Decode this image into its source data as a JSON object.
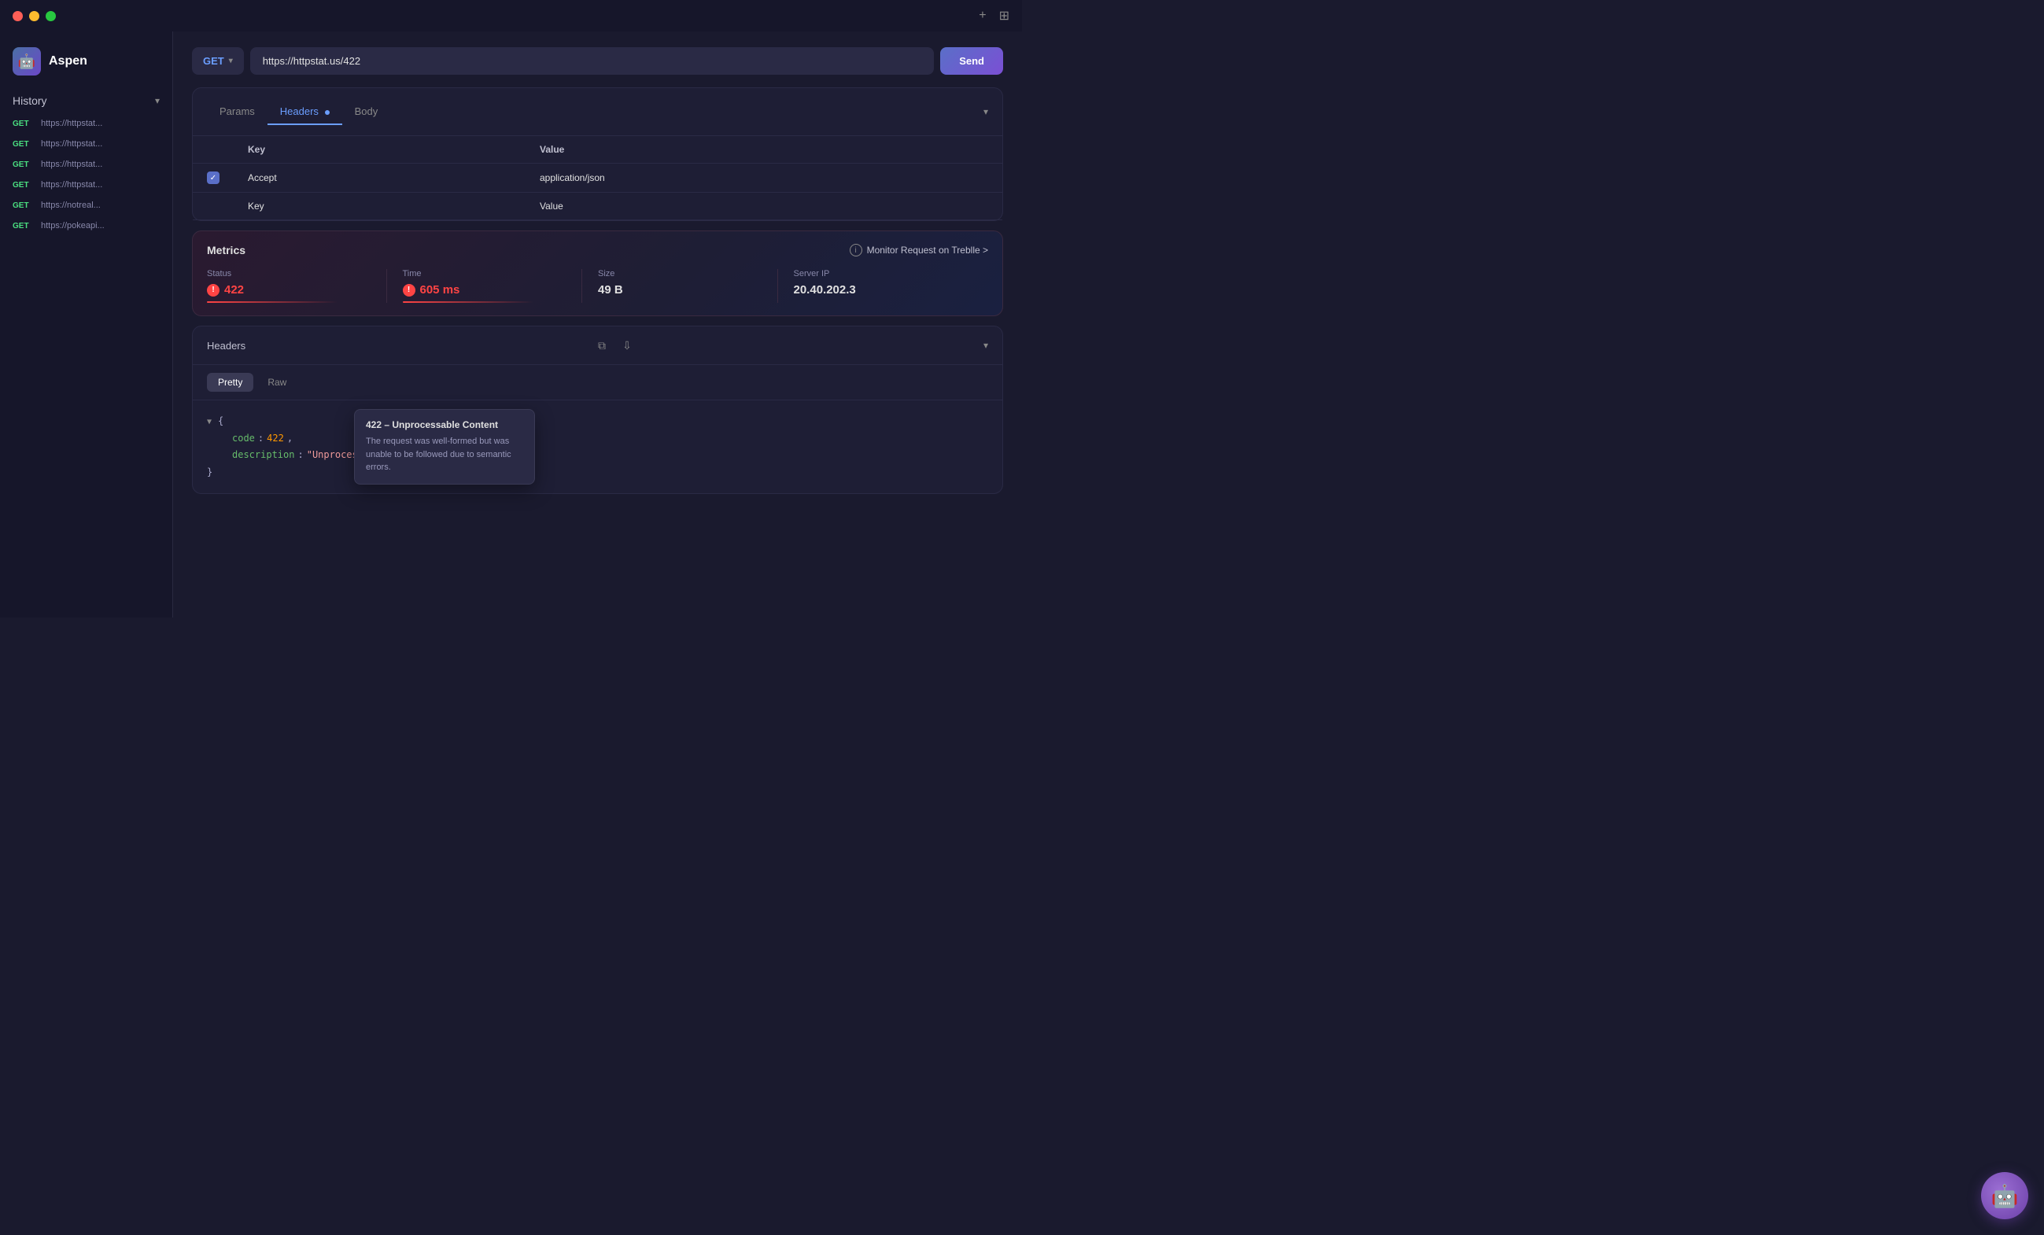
{
  "titleBar": {
    "addIcon": "+",
    "splitIcon": "⊞"
  },
  "sidebar": {
    "appName": "Aspen",
    "historyLabel": "History",
    "items": [
      {
        "method": "GET",
        "url": "https://httpstat..."
      },
      {
        "method": "GET",
        "url": "https://httpstat..."
      },
      {
        "method": "GET",
        "url": "https://httpstat..."
      },
      {
        "method": "GET",
        "url": "https://httpstat..."
      },
      {
        "method": "GET",
        "url": "https://notreal..."
      },
      {
        "method": "GET",
        "url": "https://pokeapi..."
      }
    ]
  },
  "urlBar": {
    "method": "GET",
    "url": "https://httpstat.us/422",
    "sendLabel": "Send"
  },
  "requestPanel": {
    "tabs": [
      {
        "label": "Params",
        "active": false,
        "dot": false
      },
      {
        "label": "Headers",
        "active": true,
        "dot": true
      },
      {
        "label": "Body",
        "active": false,
        "dot": false
      }
    ],
    "headers": {
      "keyCol": "Key",
      "valueCol": "Value",
      "rows": [
        {
          "enabled": true,
          "key": "Accept",
          "value": "application/json"
        },
        {
          "enabled": false,
          "key": "Key",
          "value": "Value"
        }
      ]
    }
  },
  "metrics": {
    "title": "Metrics",
    "monitorLink": "Monitor Request on Treblle >",
    "items": [
      {
        "label": "Status",
        "value": "422",
        "type": "error"
      },
      {
        "label": "Time",
        "value": "605 ms",
        "type": "error"
      },
      {
        "label": "Size",
        "value": "49 B",
        "type": "normal"
      },
      {
        "label": "Server IP",
        "value": "20.40.202.3",
        "type": "normal"
      }
    ]
  },
  "tooltip": {
    "title": "422 – Unprocessable Content",
    "description": "The request was well-formed but was unable to be followed due to semantic errors."
  },
  "response": {
    "headerText": "Headers",
    "formatTabs": [
      {
        "label": "Pretty",
        "active": true
      },
      {
        "label": "Raw",
        "active": false
      }
    ],
    "code": {
      "line1": "{",
      "codeKey": "code",
      "codeVal": "422",
      "descKey": "description",
      "descVal": "\"Unprocessable Entity\"",
      "closeBracket": "}"
    }
  },
  "colors": {
    "accent": "#6b9eff",
    "error": "#ff4444",
    "success": "#4ade80",
    "bg": "#1a1a2e",
    "sidebar": "#16162a",
    "panel": "#1e1e35"
  }
}
